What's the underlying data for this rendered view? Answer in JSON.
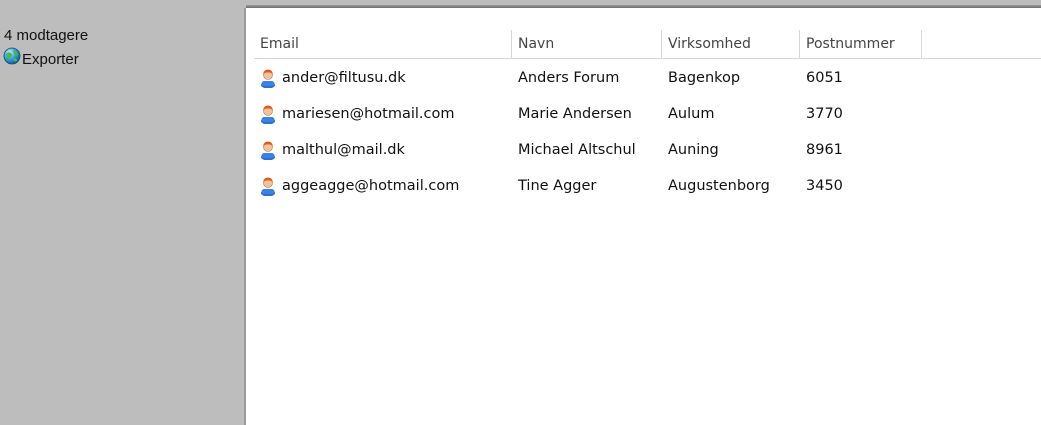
{
  "sidebar": {
    "recipient_count": "4 modtagere",
    "export_label": "Exporter",
    "export_icon": "globe-icon"
  },
  "table": {
    "columns": [
      "Email",
      "Navn",
      "Virksomhed",
      "Postnummer"
    ],
    "row_icon": "person-icon",
    "rows": [
      {
        "email": "ander@filtusu.dk",
        "navn": "Anders Forum",
        "virksomhed": "Bagenkop",
        "postnummer": "6051"
      },
      {
        "email": "mariesen@hotmail.com",
        "navn": "Marie Andersen",
        "virksomhed": "Aulum",
        "postnummer": "3770"
      },
      {
        "email": "malthul@mail.dk",
        "navn": "Michael Altschul",
        "virksomhed": "Auning",
        "postnummer": "8961"
      },
      {
        "email": "aggeagge@hotmail.com",
        "navn": "Tine Agger",
        "virksomhed": "Augustenborg",
        "postnummer": "3450"
      }
    ]
  }
}
